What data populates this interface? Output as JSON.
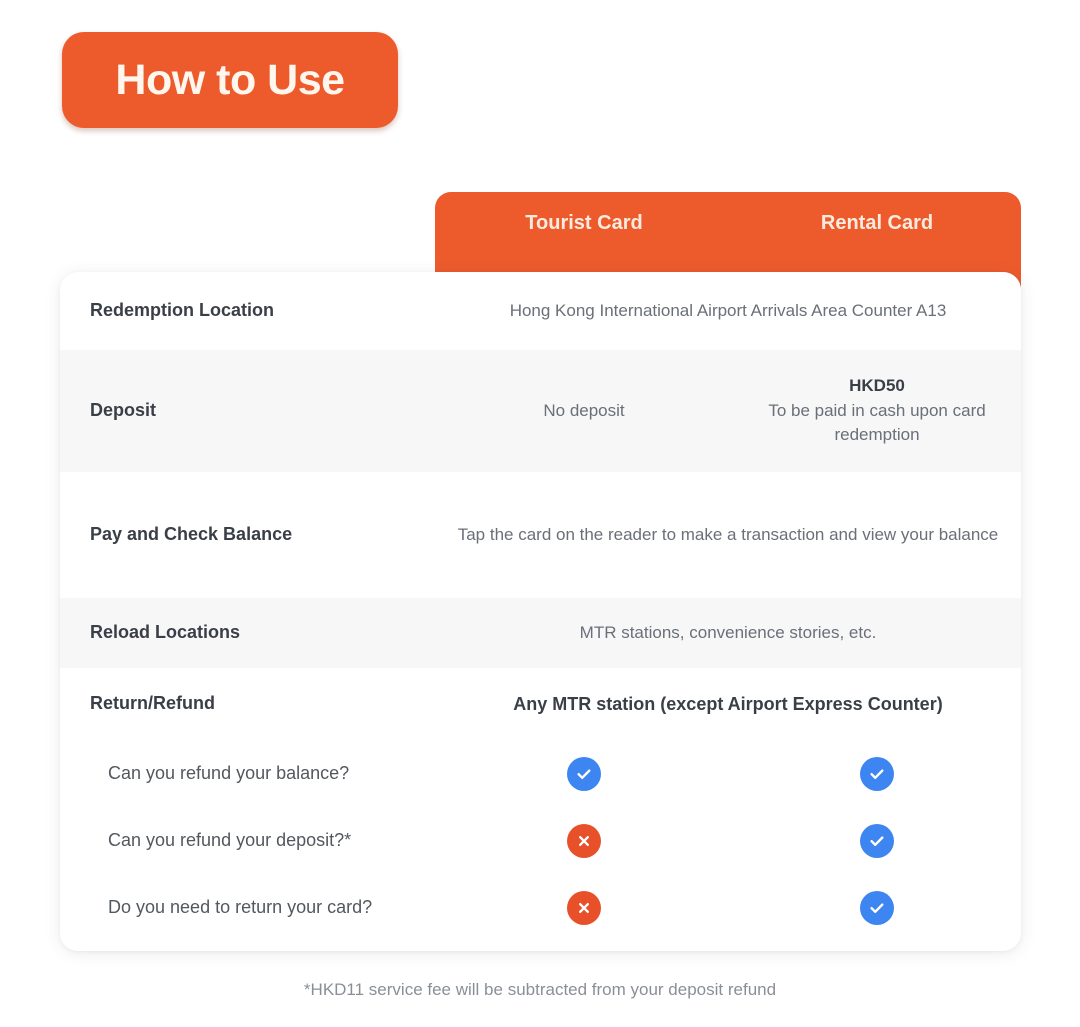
{
  "page": {
    "title": "How to Use",
    "footnote": "*HKD11 service fee will be subtracted from your deposit refund"
  },
  "colors": {
    "brand_orange": "#ED5B2D",
    "check_blue": "#3D85F0",
    "cross_red": "#E8502A",
    "row_shaded": "#F7F7F8",
    "label_text": "#3A3F47",
    "value_text": "#6A6F78"
  },
  "table": {
    "columns": [
      {
        "key": "tourist",
        "label": "Tourist Card"
      },
      {
        "key": "rental",
        "label": "Rental Card"
      }
    ],
    "rows": [
      {
        "label": "Redemption Location",
        "merged": true,
        "merged_value": "Hong Kong International Airport Arrivals Area Counter A13"
      },
      {
        "label": "Deposit",
        "tourist_value": "No deposit",
        "rental_value_strong": "HKD50",
        "rental_value": "To be paid in cash upon card redemption"
      },
      {
        "label": "Pay and Check Balance",
        "merged": true,
        "merged_value": "Tap the card on the reader to make a transaction and view your balance"
      },
      {
        "label": "Reload Locations",
        "merged": true,
        "merged_value": "MTR stations, convenience stories, etc."
      },
      {
        "label": "Return/Refund",
        "merged": true,
        "merged_value": "Any MTR station (except Airport Express Counter)",
        "merged_bold": true
      }
    ],
    "questions": [
      {
        "label": "Can you refund your balance?",
        "tourist": "check",
        "rental": "check"
      },
      {
        "label": "Can you refund your deposit?*",
        "tourist": "cross",
        "rental": "check"
      },
      {
        "label": "Do you need to return your card?",
        "tourist": "cross",
        "rental": "check"
      }
    ]
  },
  "icons": {
    "check": "check-circle-icon",
    "cross": "cross-circle-icon"
  }
}
